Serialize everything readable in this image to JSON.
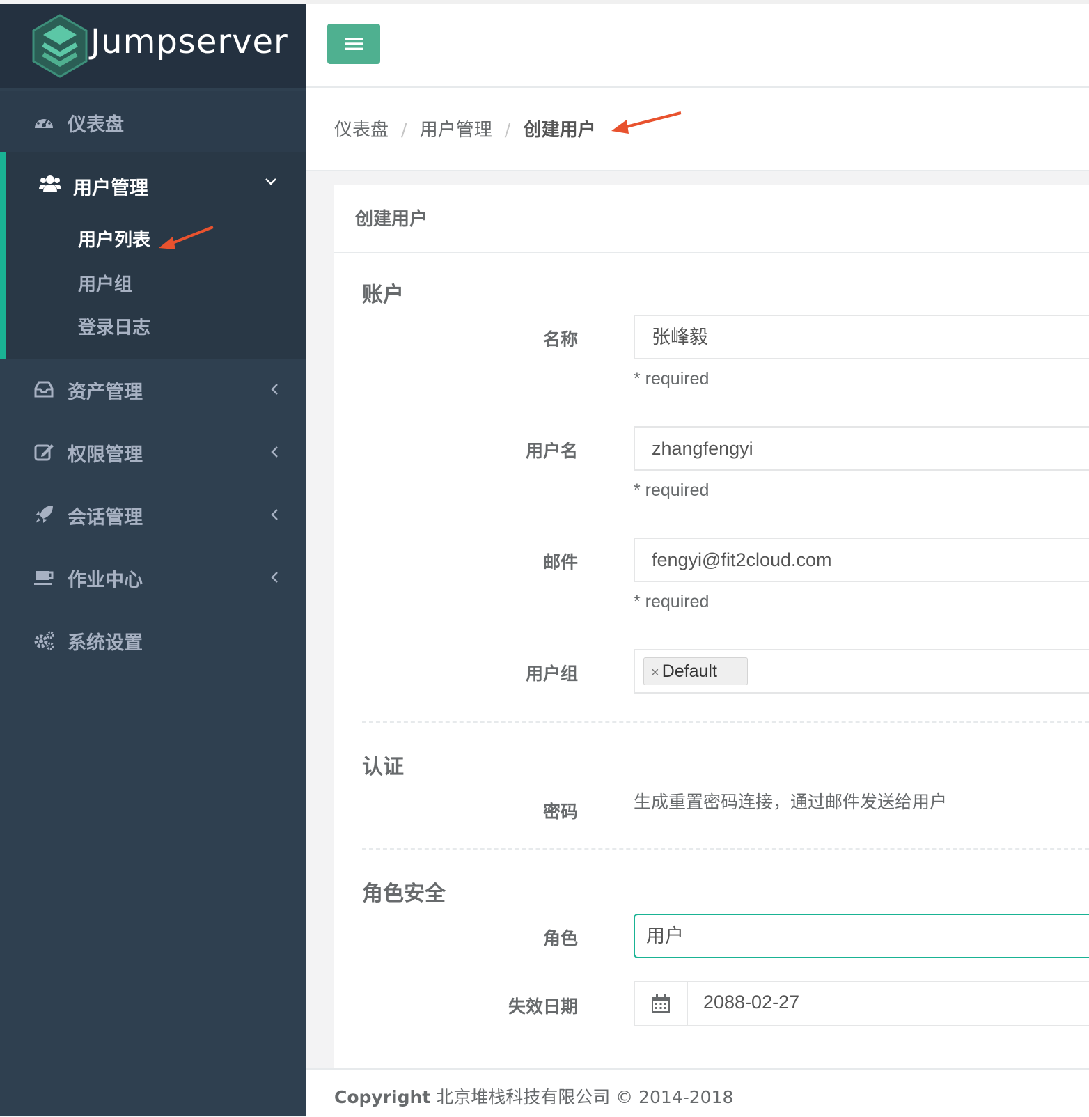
{
  "brand": {
    "name": "Jumpserver"
  },
  "sidebar": {
    "items": [
      {
        "label": "仪表盘",
        "icon": "dashboard-icon"
      },
      {
        "label": "用户管理",
        "icon": "users-icon",
        "expanded": true,
        "children": [
          {
            "label": "用户列表",
            "active": true
          },
          {
            "label": "用户组"
          },
          {
            "label": "登录日志"
          }
        ]
      },
      {
        "label": "资产管理",
        "icon": "inbox-icon"
      },
      {
        "label": "权限管理",
        "icon": "edit-icon"
      },
      {
        "label": "会话管理",
        "icon": "rocket-icon"
      },
      {
        "label": "作业中心",
        "icon": "coffee-icon"
      },
      {
        "label": "系统设置",
        "icon": "gears-icon"
      }
    ]
  },
  "breadcrumb": {
    "items": [
      "仪表盘",
      "用户管理",
      "创建用户"
    ],
    "separator": "/"
  },
  "panel": {
    "title": "创建用户",
    "sections": {
      "account": "账户",
      "auth": "认证",
      "role_security": "角色安全"
    },
    "fields": {
      "name": {
        "label": "名称",
        "value": "张峰毅",
        "help": "* required"
      },
      "username": {
        "label": "用户名",
        "value": "zhangfengyi",
        "help": "* required"
      },
      "email": {
        "label": "邮件",
        "value": "fengyi@fit2cloud.com",
        "help": "* required"
      },
      "groups": {
        "label": "用户组",
        "tags": [
          "Default"
        ],
        "remove_glyph": "×"
      },
      "password": {
        "label": "密码",
        "note": "生成重置密码连接，通过邮件发送给用户"
      },
      "role": {
        "label": "角色",
        "value": "用户"
      },
      "expiry": {
        "label": "失效日期",
        "value": "2088-02-27"
      }
    }
  },
  "footer": {
    "copyright_label": "Copyright",
    "company": "北京堆栈科技有限公司 © 2014-2018"
  },
  "colors": {
    "accent": "#1ab394",
    "sidebar": "#2f4050",
    "toggle": "#4fb090",
    "annotation_arrow": "#e8522e"
  }
}
